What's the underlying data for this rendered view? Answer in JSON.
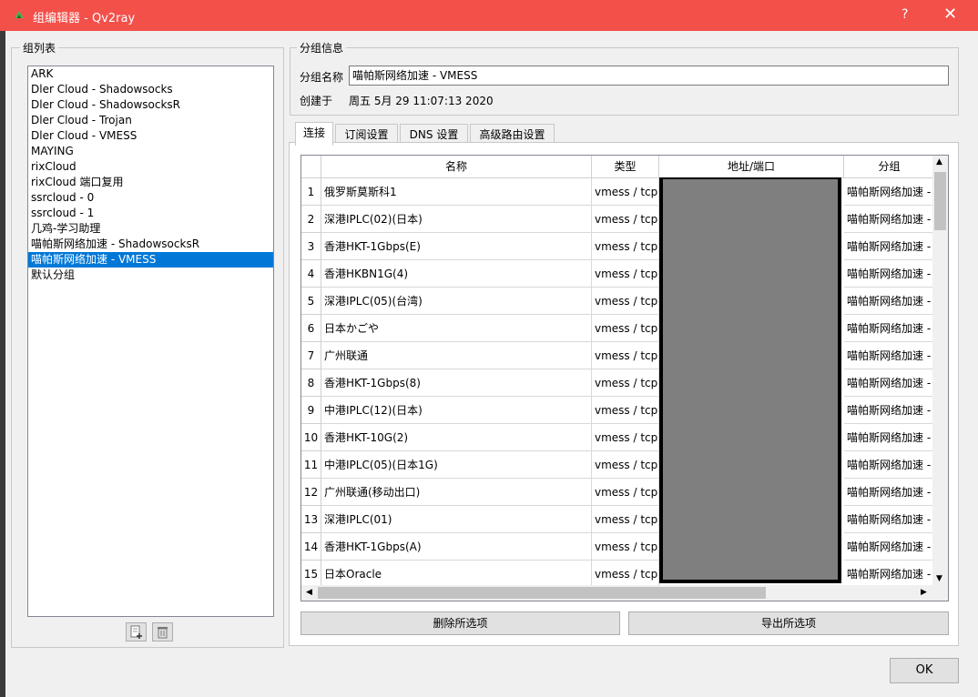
{
  "window": {
    "title": "组编辑器 - Qv2ray",
    "help": "?",
    "close": "✕",
    "accent": "#f3504a"
  },
  "group_list": {
    "title": "组列表",
    "items": [
      "ARK",
      "Dler Cloud - Shadowsocks",
      "Dler Cloud - ShadowsocksR",
      "Dler Cloud - Trojan",
      "Dler Cloud - VMESS",
      "MAYING",
      "rixCloud",
      "rixCloud 端口复用",
      "ssrcloud - 0",
      "ssrcloud - 1",
      "几鸡-学习助理",
      "喵帕斯网络加速 - ShadowsocksR",
      "喵帕斯网络加速 - VMESS",
      "默认分组"
    ],
    "selected_index": 12,
    "add_icon": "add-group-icon",
    "delete_icon": "trash-icon"
  },
  "group_info": {
    "title": "分组信息",
    "name_label": "分组名称",
    "name_value": "喵帕斯网络加速 - VMESS",
    "created_label": "创建于",
    "created_value": "周五 5月 29 11:07:13 2020"
  },
  "tabs": [
    "连接",
    "订阅设置",
    "DNS 设置",
    "高级路由设置"
  ],
  "active_tab": 0,
  "table": {
    "columns": [
      "名称",
      "类型",
      "地址/端口",
      "分组"
    ],
    "rows": [
      {
        "n": "1",
        "name": "俄罗斯莫斯科1",
        "type": "vmess / tcp",
        "group": "喵帕斯网络加速 -"
      },
      {
        "n": "2",
        "name": "深港IPLC(02)(日本)",
        "type": "vmess / tcp",
        "group": "喵帕斯网络加速 -"
      },
      {
        "n": "3",
        "name": "香港HKT-1Gbps(E)",
        "type": "vmess / tcp",
        "group": "喵帕斯网络加速 -"
      },
      {
        "n": "4",
        "name": "香港HKBN1G(4)",
        "type": "vmess / tcp",
        "group": "喵帕斯网络加速 -"
      },
      {
        "n": "5",
        "name": "深港IPLC(05)(台湾)",
        "type": "vmess / tcp",
        "group": "喵帕斯网络加速 -"
      },
      {
        "n": "6",
        "name": "日本かごや",
        "type": "vmess / tcp",
        "group": "喵帕斯网络加速 -"
      },
      {
        "n": "7",
        "name": "广州联通",
        "type": "vmess / tcp",
        "group": "喵帕斯网络加速 -"
      },
      {
        "n": "8",
        "name": "香港HKT-1Gbps(8)",
        "type": "vmess / tcp",
        "group": "喵帕斯网络加速 -"
      },
      {
        "n": "9",
        "name": "中港IPLC(12)(日本)",
        "type": "vmess / tcp",
        "group": "喵帕斯网络加速 -"
      },
      {
        "n": "10",
        "name": "香港HKT-10G(2)",
        "type": "vmess / tcp",
        "group": "喵帕斯网络加速 -"
      },
      {
        "n": "11",
        "name": "中港IPLC(05)(日本1G)",
        "type": "vmess / tcp",
        "group": "喵帕斯网络加速 -"
      },
      {
        "n": "12",
        "name": "广州联通(移动出口)",
        "type": "vmess / tcp",
        "group": "喵帕斯网络加速 -"
      },
      {
        "n": "13",
        "name": "深港IPLC(01)",
        "type": "vmess / tcp",
        "group": "喵帕斯网络加速 -"
      },
      {
        "n": "14",
        "name": "香港HKT-1Gbps(A)",
        "type": "vmess / tcp",
        "group": "喵帕斯网络加速 -"
      },
      {
        "n": "15",
        "name": "日本Oracle",
        "type": "vmess / tcp",
        "group": "喵帕斯网络加速 -"
      }
    ]
  },
  "buttons": {
    "delete_selected": "删除所选项",
    "export_selected": "导出所选项",
    "ok": "OK"
  }
}
